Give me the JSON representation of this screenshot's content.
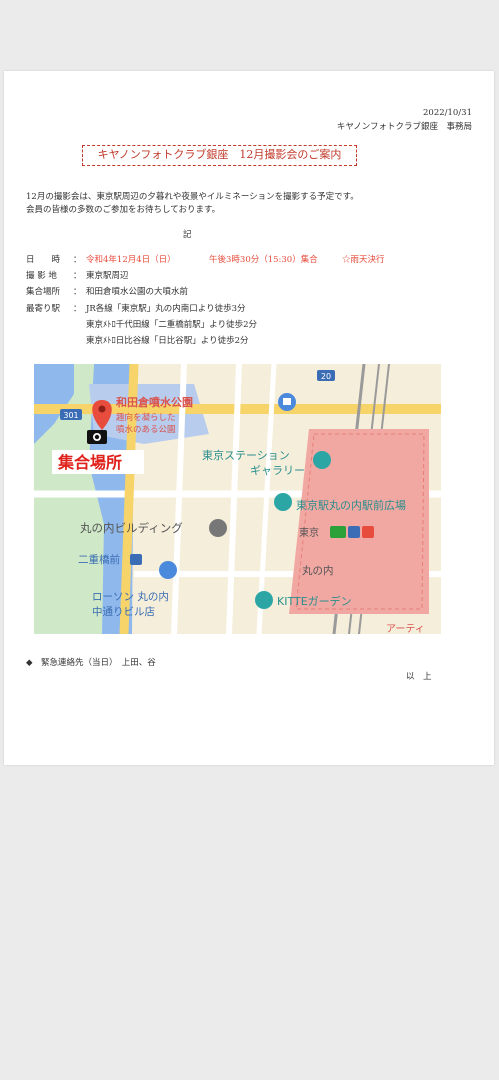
{
  "doc": {
    "date": "2022/10/31",
    "org": "キヤノンフォトクラブ銀座　事務局",
    "title": "キヤノンフォトクラブ銀座　12月撮影会のご案内",
    "intro1": "12月の撮影会は、東京駅周辺の夕暮れや夜景やイルミネーションを撮影する予定です。",
    "intro2": "会員の皆様の多数のご参加をお待ちしております。",
    "ki": "記",
    "rows": [
      {
        "label": "日　　時",
        "colon": "：",
        "value": "令和4年12月4日（日）",
        "value2": "午後3時30分（15:30）集合",
        "value3": "☆雨天決行"
      },
      {
        "label": "撮 影 地",
        "colon": "：",
        "value": "東京駅周辺"
      },
      {
        "label": "集合場所",
        "colon": "：",
        "value": "和田倉噴水公園の大噴水前"
      },
      {
        "label": "最寄り駅",
        "colon": "：",
        "value": "JR各線「東京駅」丸の内南口より徒歩3分"
      }
    ],
    "station2": "東京ﾒﾄﾛ千代田線「二重橋前駅」より徒歩2分",
    "station3": "東京ﾒﾄﾛ日比谷線「日比谷駅」より徒歩2分",
    "contact": "◆　緊急連絡先（当日）　上田、谷",
    "end": "以　上"
  },
  "map": {
    "park_name": "和田倉噴水公園",
    "park_sub1": "趣向を凝らした",
    "park_sub2": "噴水のある公園",
    "meeting": "集合場所",
    "gallery1": "東京ステーション",
    "gallery2": "ギャラリー",
    "plaza": "東京駅丸の内駅前広場",
    "marunouchi_bldg": "丸の内ビルディング",
    "nijubashi": "二重橋前",
    "tokyo": "東京",
    "marunouchi": "丸の内",
    "lawson1": "ローソン 丸の内",
    "lawson2": "中通りビル店",
    "kitte": "KITTEガーデン",
    "route301": "301",
    "route20": "20",
    "arty": "アーティ",
    "colors": {
      "red": "#e74c3c",
      "teal": "#2ca6a4",
      "blue": "#4a89dc",
      "road": "#f2c84b"
    }
  }
}
